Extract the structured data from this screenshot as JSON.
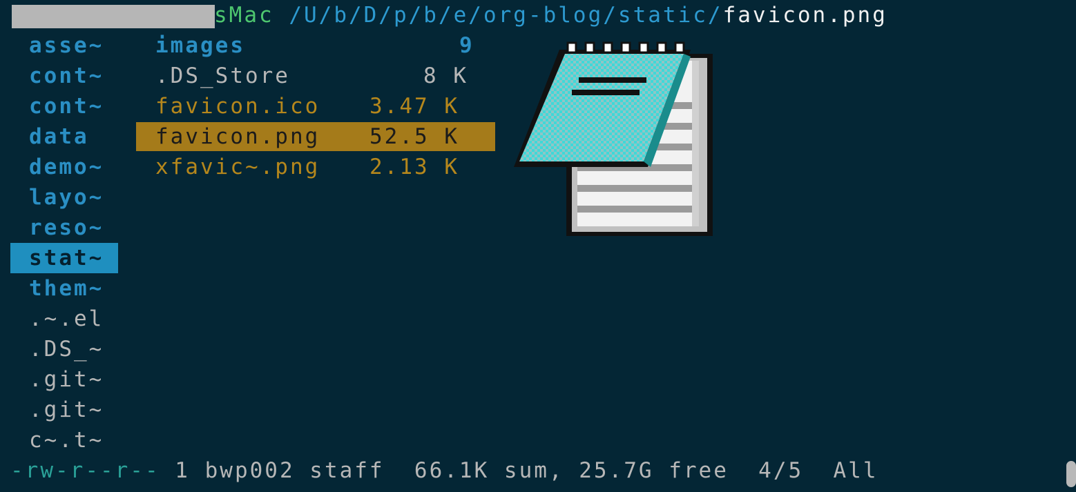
{
  "header": {
    "host_visible": "sMac",
    "path": "/U/b/D/p/b/e/org-blog/static/",
    "filename": "favicon.png"
  },
  "parent_column": [
    "asse~",
    "cont~",
    "cont~",
    "data",
    "demo~",
    "layo~",
    "reso~",
    "stat~",
    "them~",
    ".~.el",
    ".DS_~",
    ".git~",
    ".git~",
    "c~.t~"
  ],
  "current_column": [
    {
      "name": "images",
      "size": "9"
    },
    {
      "name": ".DS_Store",
      "size": "8 K"
    },
    {
      "name": "favicon.ico",
      "size": "3.47 K"
    },
    {
      "name": "favicon.png",
      "size": "52.5 K"
    },
    {
      "name": "xfavic~.png",
      "size": "2.13 K"
    }
  ],
  "status": {
    "permissions": "-rw-r--r--",
    "info": " 1 bwp002 staff  66.1K sum, 25.7G free  4/5  All"
  },
  "preview": {
    "icon": "notepad-icon"
  },
  "colors": {
    "background": "#042635",
    "selection": "#a57b1a",
    "dir": "#2a8fc4"
  }
}
